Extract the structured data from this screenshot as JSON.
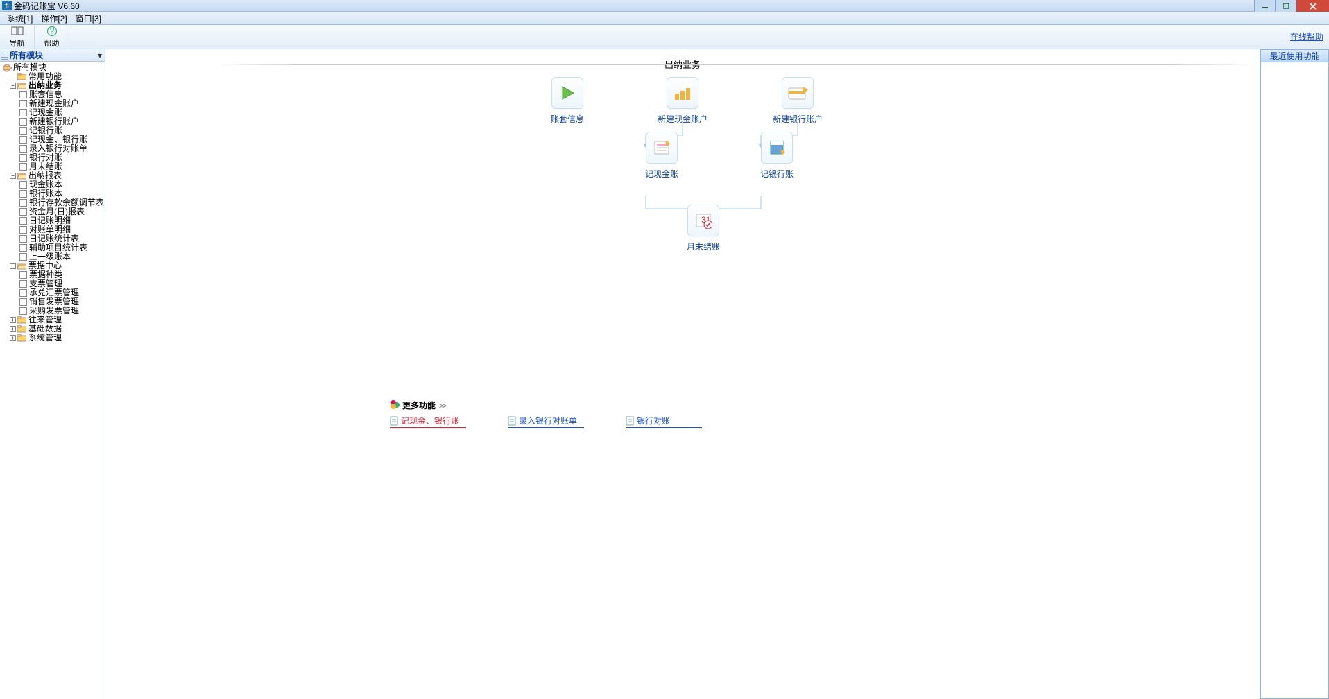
{
  "title": "金码记账宝  V6.60",
  "menu": {
    "m1": "系统[1]",
    "m2": "操作[2]",
    "m3": "窗口[3]"
  },
  "toolbar": {
    "nav": "导航",
    "help": "帮助",
    "online_help": "在线帮助"
  },
  "left_header": "所有模块",
  "tree": {
    "root": "所有模块",
    "n_common": "常用功能",
    "n_cashier": "出纳业务",
    "c1": "账套信息",
    "c2": "新建现金账户",
    "c3": "记现金账",
    "c4": "新建银行账户",
    "c5": "记银行账",
    "c6": "记现金、银行账",
    "c7": "录入银行对账单",
    "c8": "银行对账",
    "c9": "月末结账",
    "n_report": "出纳报表",
    "r1": "现金账本",
    "r2": "银行账本",
    "r3": "银行存款余额调节表",
    "r4": "资金月(日)报表",
    "r5": "日记账明细",
    "r6": "对账单明细",
    "r7": "日记账统计表",
    "r8": "辅助项目统计表",
    "r9": "上一级账本",
    "n_bill": "票据中心",
    "b1": "票据种类",
    "b2": "支票管理",
    "b3": "承兑汇票管理",
    "b4": "销售发票管理",
    "b5": "采购发票管理",
    "n_ar": "往来管理",
    "n_base": "基础数据",
    "n_sys": "系统管理"
  },
  "main": {
    "title": "出纳业务",
    "f1": "账套信息",
    "f2": "新建现金账户",
    "f3": "新建银行账户",
    "f4": "记现金账",
    "f5": "记银行账",
    "f6": "月末结账",
    "more": "更多功能",
    "ml1": "记现金、银行账",
    "ml2": "录入银行对账单",
    "ml3": "银行对账"
  },
  "right": {
    "hdr": "最近使用功能"
  }
}
